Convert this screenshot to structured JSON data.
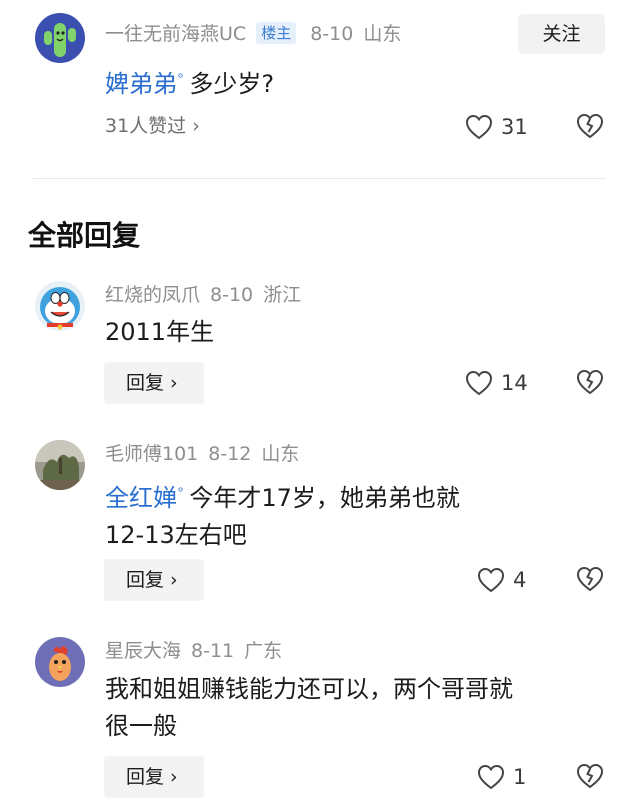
{
  "op_post": {
    "author": "一往无前海燕UC",
    "badge": "楼主",
    "date": "8-10",
    "location": "山东",
    "follow_label": "关注",
    "mention": "婢弟弟",
    "text": "多少岁?",
    "likes_link": "31人赞过 ›",
    "like_count": "31"
  },
  "section_title": "全部回复",
  "replies": [
    {
      "author": "红烧的凤爪",
      "date": "8-10",
      "location": "浙江",
      "text": "2011年生",
      "reply_label": "回复 ›",
      "like_count": "14"
    },
    {
      "author": "毛师傅101",
      "date": "8-12",
      "location": "山东",
      "mention": "全红婵",
      "text_line1": "今年才17岁，她弟弟也就",
      "text_line2": "12-13左右吧",
      "reply_label": "回复 ›",
      "like_count": "4"
    },
    {
      "author": "星辰大海",
      "date": "8-11",
      "location": "广东",
      "text_line1": "我和姐姐赚钱能力还可以，两个哥哥就",
      "text_line2": "很一般",
      "reply_label": "回复 ›",
      "like_count": "1"
    }
  ],
  "icons": {
    "like": "heart-outline-icon",
    "dislike": "broken-heart-icon",
    "mention": "search-icon"
  },
  "colors": {
    "mention": "#2a6fd0",
    "badge_bg": "#e6f0fb",
    "meta_text": "#8e8e8e"
  }
}
